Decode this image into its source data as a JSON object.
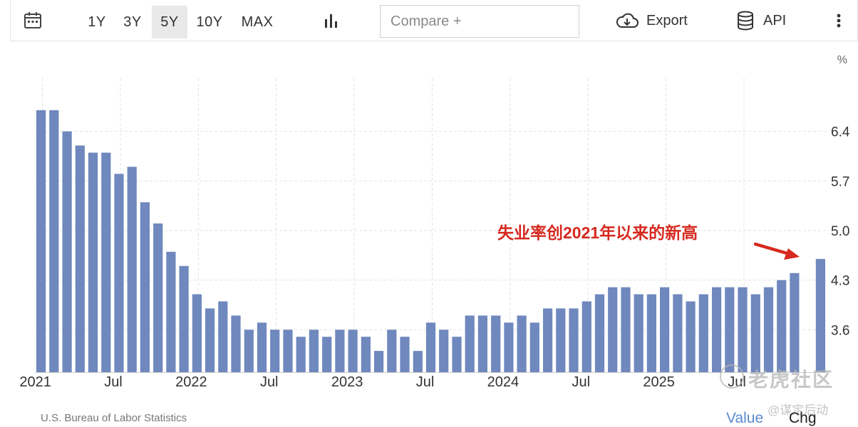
{
  "toolbar": {
    "ranges": [
      "1Y",
      "3Y",
      "5Y",
      "10Y",
      "MAX"
    ],
    "active_range": "5Y",
    "compare_placeholder": "Compare +",
    "export_label": "Export",
    "api_label": "API"
  },
  "footer": {
    "source": "U.S. Bureau of Labor Statistics",
    "value_label": "Value",
    "chg_label": "Chg"
  },
  "watermark": {
    "text": "老虎社区",
    "sub": "@谋定后动"
  },
  "colors": {
    "bar": "#6f88bd",
    "annotation": "#d6291f",
    "link": "#5b8ad0"
  },
  "chart_data": {
    "type": "bar",
    "unit": "%",
    "ylim": [
      3.0,
      7.15
    ],
    "yticks": [
      3.6,
      4.3,
      5.0,
      5.7,
      6.4
    ],
    "grid": true,
    "x_tick_labels": [
      "2021",
      "Jul",
      "2022",
      "Jul",
      "2023",
      "Jul",
      "2024",
      "Jul",
      "2025",
      "Jul"
    ],
    "x_tick_index": [
      0,
      6,
      12,
      18,
      24,
      30,
      36,
      42,
      48,
      54
    ],
    "x": [
      "2021-01",
      "2021-02",
      "2021-03",
      "2021-04",
      "2021-05",
      "2021-06",
      "2021-07",
      "2021-08",
      "2021-09",
      "2021-10",
      "2021-11",
      "2021-12",
      "2022-01",
      "2022-02",
      "2022-03",
      "2022-04",
      "2022-05",
      "2022-06",
      "2022-07",
      "2022-08",
      "2022-09",
      "2022-10",
      "2022-11",
      "2022-12",
      "2023-01",
      "2023-02",
      "2023-03",
      "2023-04",
      "2023-05",
      "2023-06",
      "2023-07",
      "2023-08",
      "2023-09",
      "2023-10",
      "2023-11",
      "2023-12",
      "2024-01",
      "2024-02",
      "2024-03",
      "2024-04",
      "2024-05",
      "2024-06",
      "2024-07",
      "2024-08",
      "2024-09",
      "2024-10",
      "2024-11",
      "2024-12",
      "2025-01",
      "2025-02",
      "2025-03",
      "2025-04",
      "2025-05",
      "2025-06",
      "2025-07",
      "2025-08",
      "2025-09",
      "2025-10",
      "2025-11"
    ],
    "values": [
      6.7,
      6.7,
      6.4,
      6.2,
      6.1,
      6.1,
      5.8,
      5.9,
      5.4,
      5.1,
      4.7,
      4.5,
      4.1,
      3.9,
      4.0,
      3.8,
      3.6,
      3.7,
      3.6,
      3.6,
      3.5,
      3.6,
      3.5,
      3.6,
      3.6,
      3.5,
      3.3,
      3.6,
      3.5,
      3.3,
      3.7,
      3.6,
      3.5,
      3.8,
      3.8,
      3.8,
      3.7,
      3.8,
      3.7,
      3.9,
      3.9,
      3.9,
      4.0,
      4.1,
      4.2,
      4.2,
      4.1,
      4.1,
      4.2,
      4.1,
      4.0,
      4.1,
      4.2,
      4.2,
      4.2,
      4.1,
      4.2,
      4.3,
      4.4,
      null,
      4.6
    ],
    "annotation": "失业率创2021年以来的新高"
  }
}
